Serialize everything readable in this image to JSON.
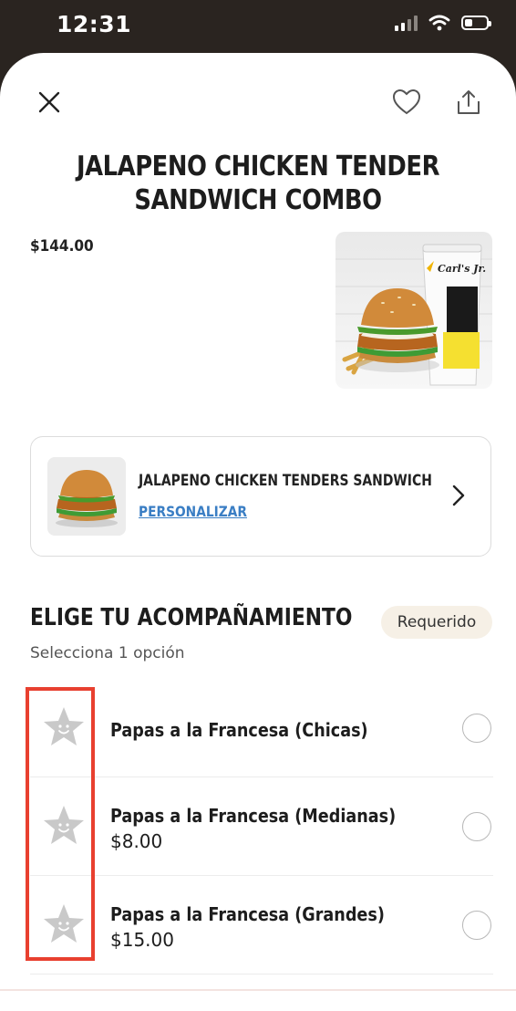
{
  "status_bar": {
    "time": "12:31"
  },
  "header": {
    "close_icon": "close-icon",
    "favorite_icon": "heart-icon",
    "share_icon": "share-icon"
  },
  "product": {
    "title": "JALAPENO CHICKEN TENDER SANDWICH COMBO",
    "price": "$144.00",
    "image_brand_text": "Carl's Jr."
  },
  "sandwich_card": {
    "name": "JALAPENO CHICKEN TENDERS SANDWICH",
    "customize_label": "PERSONALIZAR"
  },
  "side_section": {
    "title": "ELIGE TU ACOMPAÑAMIENTO",
    "required_badge": "Requerido",
    "subtitle": "Selecciona 1 opción",
    "options": [
      {
        "name": "Papas a la Francesa (Chicas)",
        "price": ""
      },
      {
        "name": "Papas a la Francesa (Medianas)",
        "price": "$8.00"
      },
      {
        "name": "Papas a la Francesa (Grandes)",
        "price": "$15.00"
      }
    ]
  },
  "colors": {
    "accent_link": "#3a7ec4",
    "highlight_box": "#e8402f",
    "badge_bg": "#f6f0e6"
  }
}
